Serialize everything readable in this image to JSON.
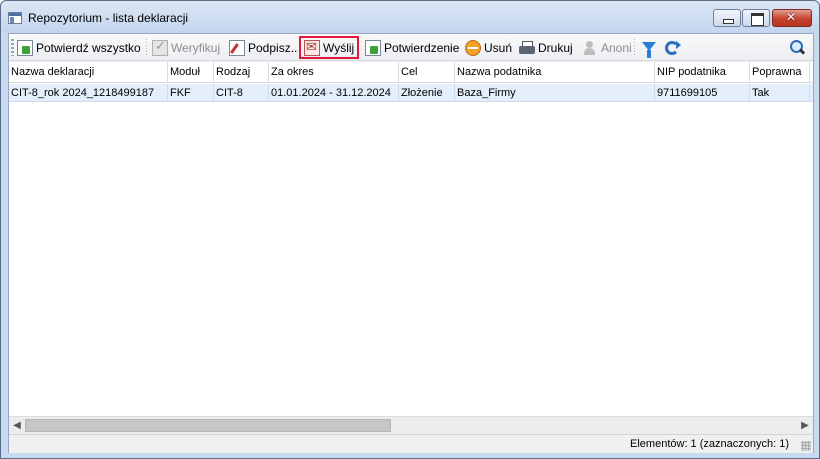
{
  "window": {
    "title": "Repozytorium - lista deklaracji"
  },
  "toolbar": {
    "items": [
      {
        "label": "Potwierdź wszystko",
        "icon": "confirm-all-icon",
        "enabled": true
      },
      {
        "label": "Weryfikuj",
        "icon": "verify-icon",
        "enabled": false
      },
      {
        "label": "Podpisz..",
        "icon": "sign-icon",
        "enabled": true
      },
      {
        "label": "Wyślij",
        "icon": "send-icon",
        "enabled": true,
        "highlighted": true
      },
      {
        "label": "Potwierdzenie",
        "icon": "confirmation-icon",
        "enabled": true
      },
      {
        "label": "Usuń",
        "icon": "delete-icon",
        "enabled": true
      },
      {
        "label": "Drukuj",
        "icon": "print-icon",
        "enabled": true
      },
      {
        "label": "Anoni",
        "icon": "anonymize-icon",
        "enabled": false
      }
    ],
    "highlight_color": "#e0193a"
  },
  "table": {
    "columns": [
      "Nazwa deklaracji",
      "Moduł",
      "Rodzaj",
      "Za okres",
      "Cel",
      "Nazwa podatnika",
      "NIP podatnika",
      "Poprawna"
    ],
    "rows": [
      [
        "CIT-8_rok 2024_1218499187",
        "FKF",
        "CIT-8",
        "01.01.2024 - 31.12.2024",
        "Złożenie",
        "Baza_Firmy",
        "9711699105",
        "Tak"
      ]
    ],
    "selected_row_color": "#e4eefa"
  },
  "status": {
    "text": "Elementów: 1 (zaznaczonych: 1)"
  }
}
